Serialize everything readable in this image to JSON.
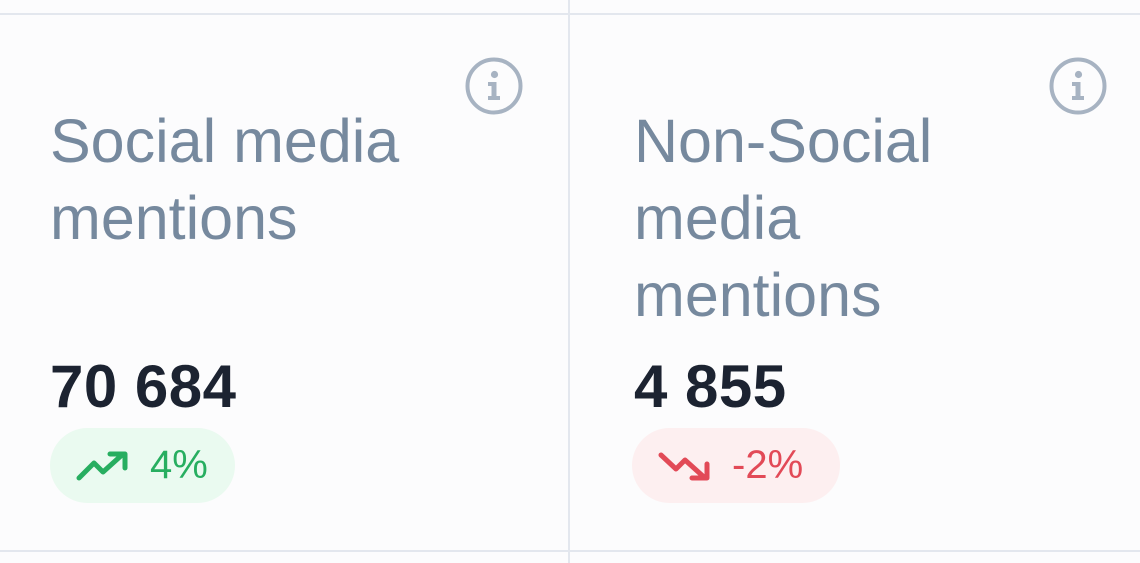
{
  "colors": {
    "title": "#76899e",
    "value": "#1c2331",
    "positive": "#27ae60",
    "positive_bg": "#eafaf0",
    "negative": "#e24a57",
    "negative_bg": "#fdeff0",
    "divider": "#e3e7ee",
    "info_icon": "#a7b3c2"
  },
  "cards": [
    {
      "title": "Social media mentions",
      "value": "70 684",
      "change": "4%",
      "trend": "up",
      "trend_icon": "trending-up-icon",
      "info_icon": "info-icon"
    },
    {
      "title": "Non-Social media mentions",
      "value": "4 855",
      "change": "-2%",
      "trend": "down",
      "trend_icon": "trending-down-icon",
      "info_icon": "info-icon"
    }
  ]
}
